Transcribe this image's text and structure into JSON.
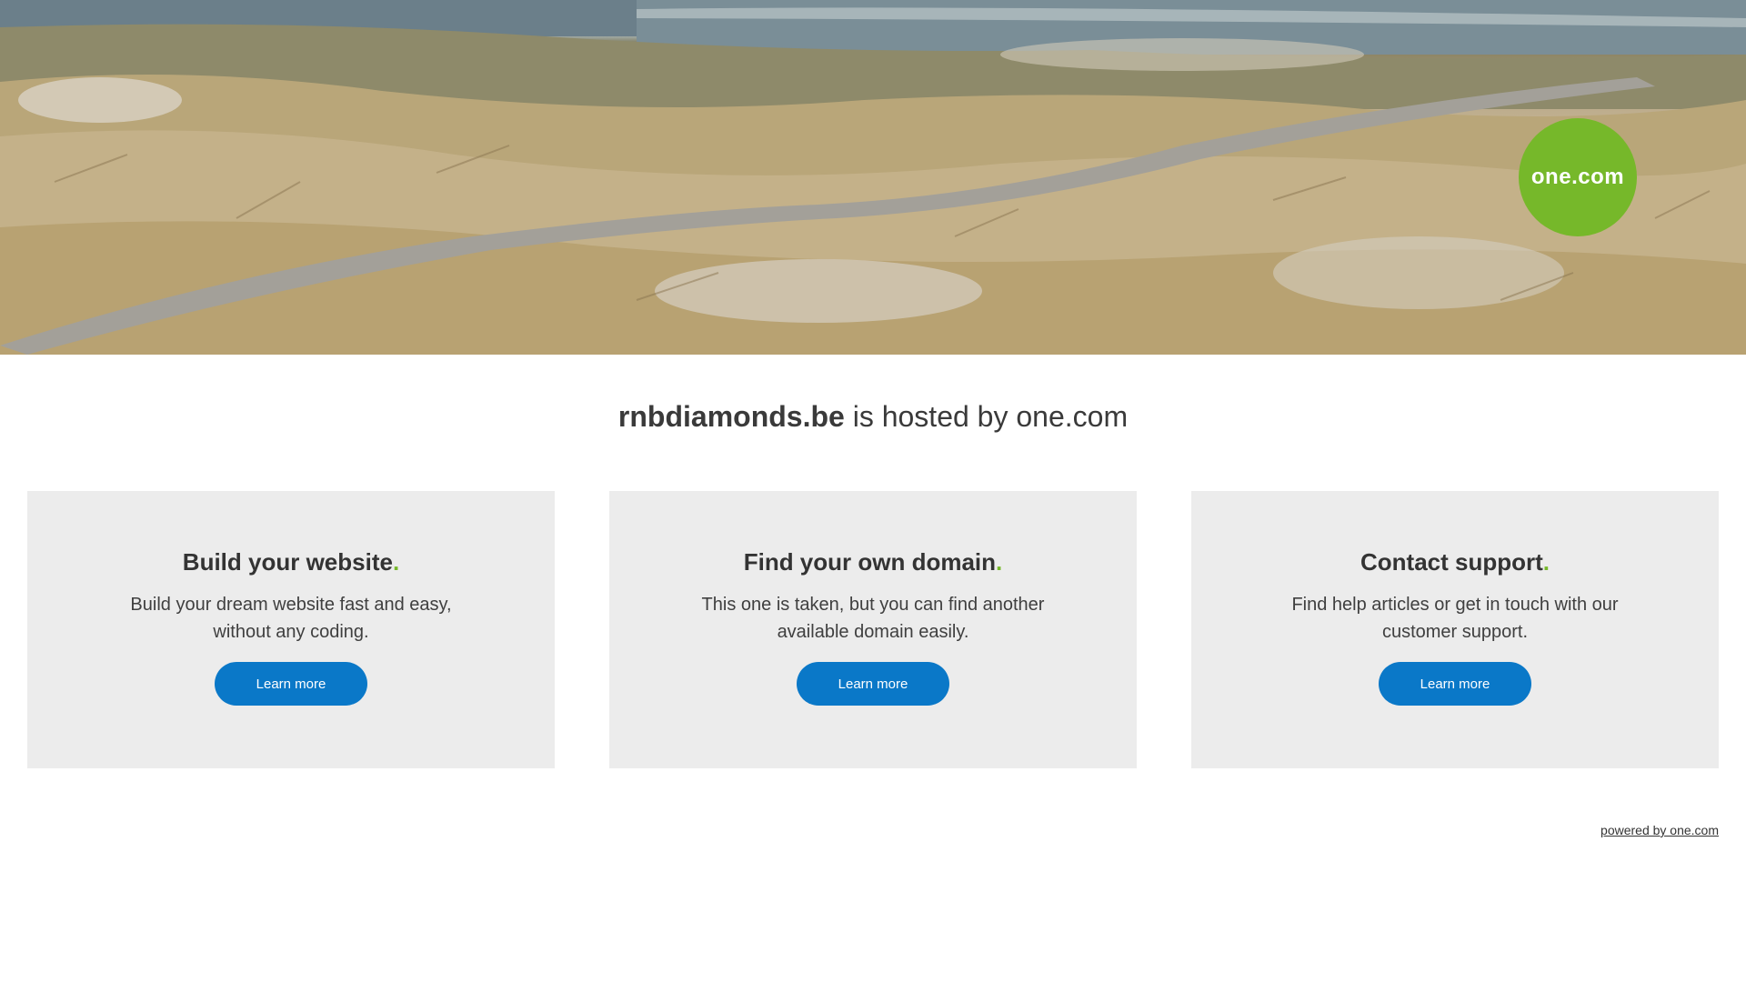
{
  "logo": {
    "text_left": "one",
    "text_dot": ".",
    "text_right": "com",
    "color": "#76b82a"
  },
  "headline": {
    "domain": "rnbdiamonds.be",
    "suffix": " is hosted by one.com"
  },
  "cards": [
    {
      "title": "Build your website",
      "accent": ".",
      "text": "Build your dream website fast and easy, without any coding.",
      "button_label": "Learn more"
    },
    {
      "title": "Find your own domain",
      "accent": ".",
      "text": "This one is taken, but you can find another available domain easily.",
      "button_label": "Learn more"
    },
    {
      "title": "Contact support",
      "accent": ".",
      "text": "Find help articles or get in touch with our customer support.",
      "button_label": "Learn more"
    }
  ],
  "footer": {
    "powered_by": "powered by one.com"
  },
  "colors": {
    "accent_green": "#76b82a",
    "button_blue": "#0a78c8",
    "card_bg": "#ececec"
  }
}
